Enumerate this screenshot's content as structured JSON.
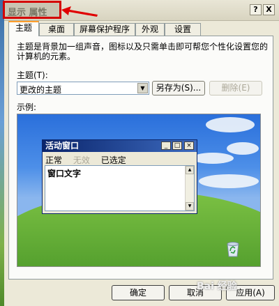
{
  "window": {
    "title": "显示 属性",
    "help_button": "?",
    "close_button": "X"
  },
  "tabs": [
    {
      "label": "主题"
    },
    {
      "label": "桌面"
    },
    {
      "label": "屏幕保护程序"
    },
    {
      "label": "外观"
    },
    {
      "label": "设置"
    }
  ],
  "themes": {
    "description": "主题是背景加一组声音，图标以及只需单击即可帮您个性化设置您的计算机的元素。",
    "theme_label": "主题(T):",
    "selected": "更改的主题",
    "save_as": "另存为(S)...",
    "delete": "删除(E)",
    "example_label": "示例:"
  },
  "preview": {
    "window_title": "活动窗口",
    "menu": [
      "正常",
      "无效",
      "已选定"
    ],
    "content_text": "窗口文字"
  },
  "footer": {
    "ok": "确定",
    "cancel": "取消",
    "apply": "应用(A)"
  },
  "watermark": "Bai 经验",
  "colors": {
    "highlight_box": "#d40000",
    "active_tab_accent": "#ff9e2b"
  }
}
